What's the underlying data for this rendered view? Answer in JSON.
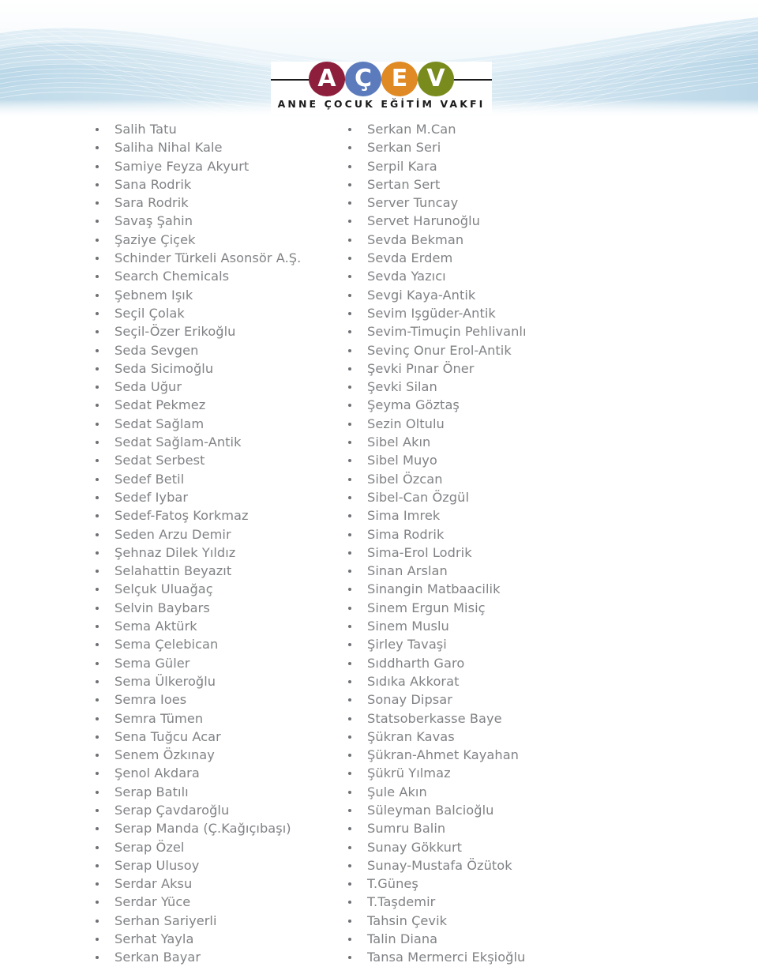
{
  "header": {
    "logo": {
      "name": "acev-logo",
      "letters": [
        {
          "char": "A",
          "color": "#8e1f3c"
        },
        {
          "char": "Ç",
          "color": "#5b7bbd"
        },
        {
          "char": "E",
          "color": "#e08a25"
        },
        {
          "char": "V",
          "color": "#7a8b1d"
        }
      ],
      "tagline": "ANNE ÇOCUK EĞİTİM VAKFI"
    },
    "wave_colors": {
      "light": "#eaf3f9",
      "mid": "#cfe3ef",
      "deep": "#bcd8e8",
      "page": "#ffffff"
    }
  },
  "list": {
    "text_color": "#808285",
    "bullet_color": "#6e7073",
    "left_column": [
      "Salih Tatu",
      "Saliha Nihal Kale",
      "Samiye Feyza Akyurt",
      "Sana Rodrik",
      "Sara Rodrik",
      "Savaş Şahin",
      "Şaziye Çiçek",
      "Schinder Türkeli Asonsör A.Ş.",
      "Search Chemicals",
      "Şebnem Işık",
      "Seçil Çolak",
      "Seçil-Özer Erikoğlu",
      "Seda Sevgen",
      "Seda Sicimoğlu",
      "Seda Uğur",
      "Sedat Pekmez",
      "Sedat Sağlam",
      "Sedat Sağlam-Antik",
      "Sedat Serbest",
      "Sedef Betil",
      "Sedef Iybar",
      "Sedef-Fatoş Korkmaz",
      "Seden Arzu Demir",
      "Şehnaz Dilek Yıldız",
      "Selahattin Beyazıt",
      "Selçuk Uluağaç",
      "Selvin Baybars",
      "Sema Aktürk",
      "Sema Çelebican",
      "Sema Güler",
      "Sema Ülkeroğlu",
      "Semra Ioes",
      "Semra Tümen",
      "Sena Tuğcu Acar",
      "Senem Özkınay",
      "Şenol Akdara",
      "Serap Batılı",
      "Serap Çavdaroğlu",
      "Serap Manda (Ç.Kağıçıbaşı)",
      "Serap Özel",
      "Serap Ulusoy",
      "Serdar Aksu",
      "Serdar Yüce",
      "Serhan Sariyerli",
      "Serhat Yayla",
      "Serkan Bayar"
    ],
    "right_column": [
      "Serkan M.Can",
      "Serkan Seri",
      "Serpil Kara",
      "Sertan Sert",
      "Server Tuncay",
      "Servet Harunoğlu",
      "Sevda Bekman",
      "Sevda Erdem",
      "Sevda Yazıcı",
      "Sevgi Kaya-Antik",
      "Sevim Işgüder-Antik",
      "Sevim-Timuçin Pehlivanlı",
      "Sevinç Onur Erol-Antik",
      "Şevki Pınar Öner",
      "Şevki Silan",
      "Şeyma Göztaş",
      "Sezin Oltulu",
      "Sibel Akın",
      "Sibel Muyo",
      "Sibel Özcan",
      "Sibel-Can Özgül",
      "Sima Imrek",
      "Sima Rodrik",
      "Sima-Erol Lodrik",
      "Sinan Arslan",
      "Sinangin Matbaacilik",
      "Sinem Ergun Misiç",
      "Sinem Muslu",
      "Şirley Tavaşi",
      "Sıddharth Garo",
      "Sıdıka Akkorat",
      "Sonay Dipsar",
      "Statsoberkasse Baye",
      "Şükran Kavas",
      "Şükran-Ahmet Kayahan",
      "Şükrü Yılmaz",
      "Şule Akın",
      "Süleyman Balcioğlu",
      "Sumru Balin",
      "Sunay Gökkurt",
      "Sunay-Mustafa Özütok",
      "T.Güneş",
      "T.Taşdemir",
      "Tahsin Çevik",
      "Talin Diana",
      "Tansa Mermerci Ekşioğlu"
    ]
  }
}
